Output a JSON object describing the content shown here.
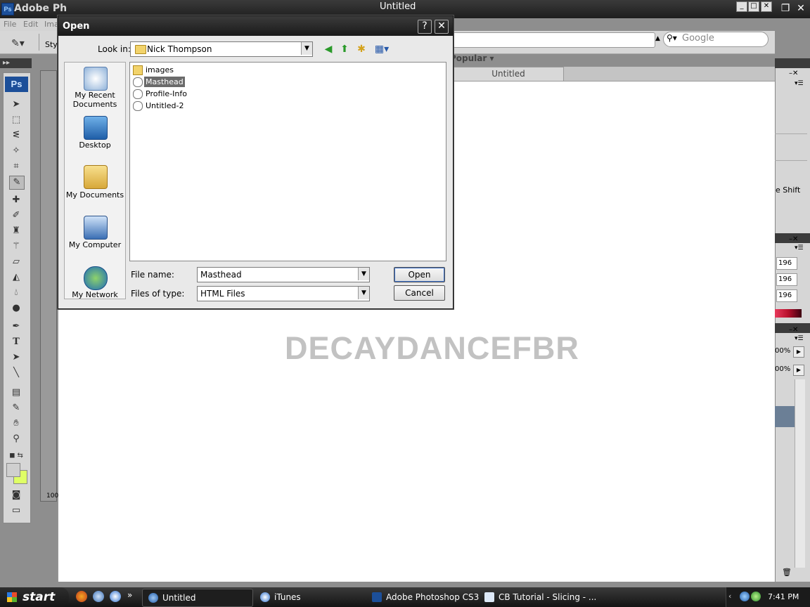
{
  "app": {
    "title": "Adobe Ph",
    "logo_text": "Ps",
    "window_title": "Untitled"
  },
  "menu": [
    "File",
    "Edit",
    "Ima"
  ],
  "options_bar": {
    "style_label": "Sty"
  },
  "browser": {
    "search_placeholder": "Google",
    "popular_label": "Popular ▾"
  },
  "document": {
    "tab_label": "Untitled",
    "watermark": "DECAYDANCEFBR"
  },
  "right_panel": {
    "shift_label": "e Shift",
    "values": [
      "196",
      "196",
      "196"
    ],
    "percent_values": [
      "00%",
      "00%"
    ]
  },
  "dialog": {
    "title": "Open",
    "help_glyph": "?",
    "close_glyph": "✕",
    "look_in_label": "Look in:",
    "look_in_value": "Nick Thompson",
    "places": [
      {
        "label": "My Recent\nDocuments",
        "icon": "recent-documents-icon"
      },
      {
        "label": "Desktop",
        "icon": "desktop-icon"
      },
      {
        "label": "My Documents",
        "icon": "my-documents-icon"
      },
      {
        "label": "My Computer",
        "icon": "my-computer-icon"
      },
      {
        "label": "My Network",
        "icon": "my-network-icon"
      }
    ],
    "files": [
      {
        "name": "images",
        "type": "folder",
        "selected": false
      },
      {
        "name": "Masthead",
        "type": "html",
        "selected": true
      },
      {
        "name": "Profile-Info",
        "type": "html",
        "selected": false
      },
      {
        "name": "Untitled-2",
        "type": "html",
        "selected": false
      }
    ],
    "file_name_label": "File name:",
    "file_name_value": "Masthead",
    "file_type_label": "Files of type:",
    "file_type_value": "HTML Files",
    "open_label": "Open",
    "cancel_label": "Cancel"
  },
  "taskbar": {
    "start_label": "start",
    "tasks": [
      {
        "label": "Untitled",
        "active": true
      },
      {
        "label": "iTunes",
        "active": false
      },
      {
        "label": "Adobe Photoshop CS3",
        "active": false
      },
      {
        "label": "CB Tutorial - Slicing - ...",
        "active": false
      }
    ],
    "clock": "7:41 PM"
  },
  "colors": {
    "accent": "#1c4f99",
    "selection": "#6b6b6b",
    "background_swatch": "#dfff66",
    "taskbar": "#1b1b1b"
  }
}
